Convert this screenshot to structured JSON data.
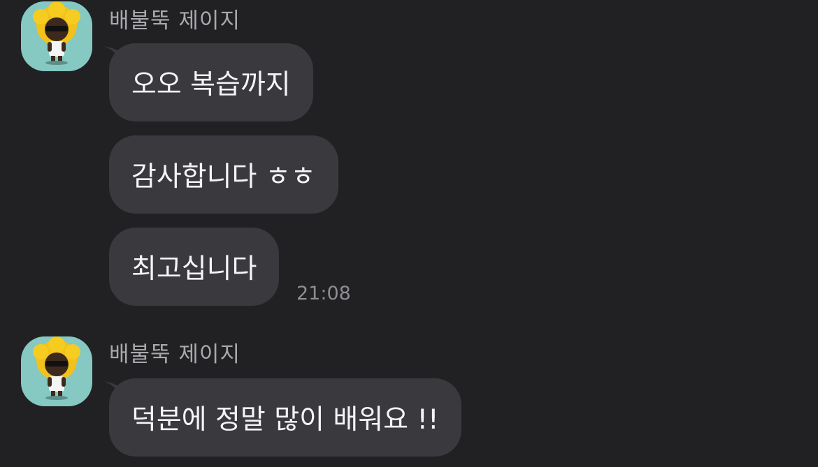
{
  "chat": {
    "groups": [
      {
        "sender": "배불뚝 제이지",
        "avatar_icon": "character-avatar-icon",
        "messages": [
          {
            "text": "오오 복습까지"
          },
          {
            "text": "감사합니다 ㅎㅎ"
          },
          {
            "text": "최고십니다",
            "time": "21:08"
          }
        ]
      },
      {
        "sender": "배불뚝 제이지",
        "avatar_icon": "character-avatar-icon",
        "messages": [
          {
            "text": "덕분에 정말 많이 배워요 !!"
          }
        ]
      }
    ]
  },
  "colors": {
    "background": "#212023",
    "bubble": "#3a393e",
    "avatar_bg": "#86c8c2",
    "sender_text": "#a9a8ad",
    "message_text": "#f4f4f6",
    "time_text": "#8e8d92"
  }
}
